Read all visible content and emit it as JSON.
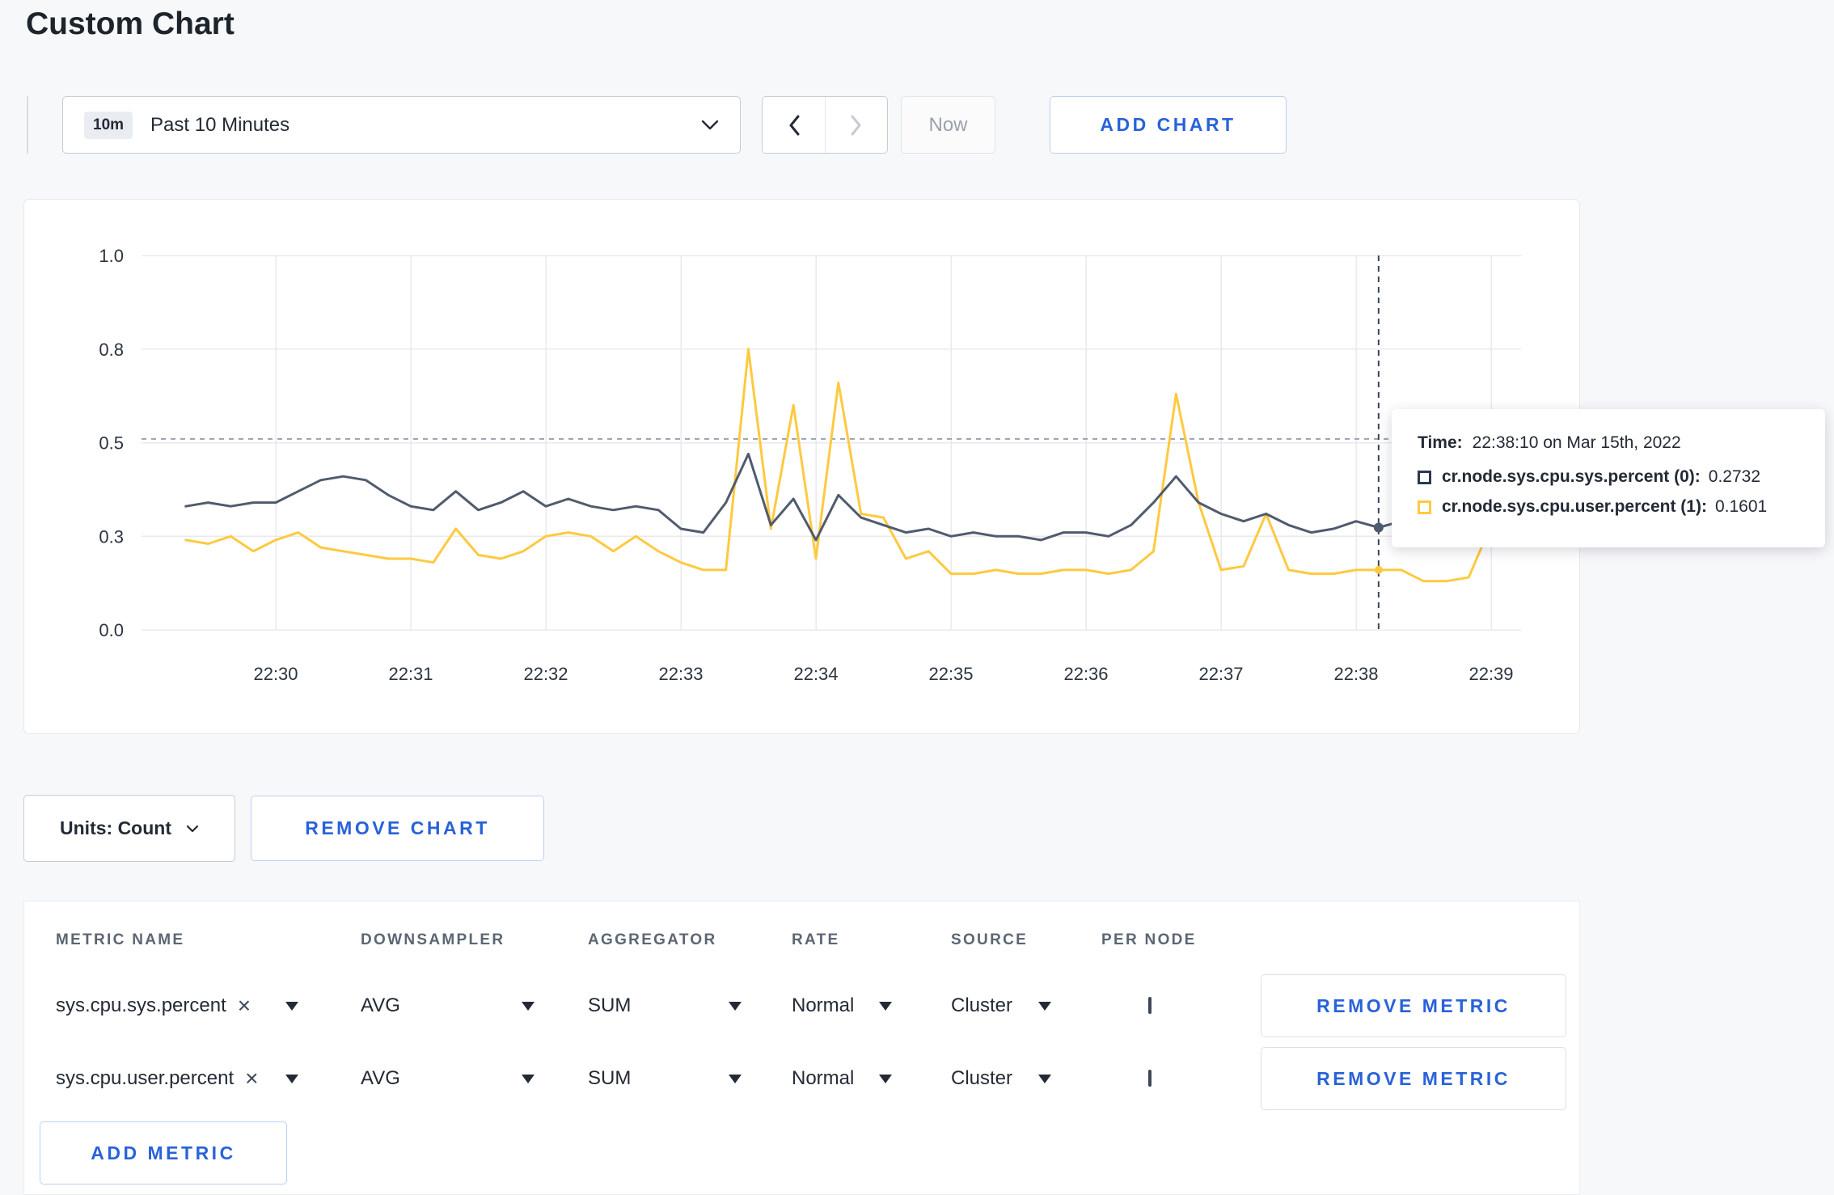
{
  "page": {
    "title": "Custom Chart"
  },
  "toolbar": {
    "time_range_badge": "10m",
    "time_range_label": "Past 10 Minutes",
    "prev_icon": "chevron-left-icon",
    "next_icon": "chevron-right-icon",
    "now_label": "Now",
    "add_chart_label": "ADD CHART"
  },
  "tooltip": {
    "time_label": "Time:",
    "time_value": "22:38:10 on Mar 15th, 2022",
    "rows": [
      {
        "name": "cr.node.sys.cpu.sys.percent (0):",
        "value": "0.2732",
        "color": "#2c3850"
      },
      {
        "name": "cr.node.sys.cpu.user.percent (1):",
        "value": "0.1601",
        "color": "#ffc940"
      }
    ]
  },
  "chart_controls": {
    "units_label": "Units: Count",
    "remove_chart_label": "REMOVE CHART",
    "add_metric_label": "ADD METRIC"
  },
  "table": {
    "headers": [
      "METRIC NAME",
      "DOWNSAMPLER",
      "AGGREGATOR",
      "RATE",
      "SOURCE",
      "PER NODE"
    ],
    "remove_metric_label": "REMOVE METRIC",
    "rows": [
      {
        "metric": "sys.cpu.sys.percent",
        "clear": "×",
        "downsampler": "AVG",
        "aggregator": "SUM",
        "rate": "Normal",
        "source": "Cluster",
        "per_node_checked": false
      },
      {
        "metric": "sys.cpu.user.percent",
        "clear": "×",
        "downsampler": "AVG",
        "aggregator": "SUM",
        "rate": "Normal",
        "source": "Cluster",
        "per_node_checked": false
      }
    ]
  },
  "chart_data": {
    "type": "line",
    "title": "",
    "xlabel": "",
    "ylabel": "",
    "x_axis": {
      "ticks": [
        "22:30",
        "22:31",
        "22:32",
        "22:33",
        "22:34",
        "22:35",
        "22:36",
        "22:37",
        "22:38",
        "22:39"
      ]
    },
    "y_axis": {
      "range": [
        0,
        1
      ],
      "ticks": [
        {
          "label": "1.0",
          "value": 1.0
        },
        {
          "label": "0.8",
          "value": 0.75
        },
        {
          "label": "0.5",
          "value": 0.5
        },
        {
          "label": "0.3",
          "value": 0.25
        },
        {
          "label": "0.0",
          "value": 0.0
        }
      ]
    },
    "grid": true,
    "legend_position": "tooltip",
    "x_start_time": "22:29:20",
    "x_step_seconds": 10,
    "x_start_offset_minutes": -0.6667,
    "x_step_minutes": 0.16667,
    "series": [
      {
        "name": "cr.node.sys.cpu.sys.percent",
        "color": "#515b6e",
        "values": [
          0.33,
          0.34,
          0.33,
          0.34,
          0.34,
          0.37,
          0.4,
          0.41,
          0.4,
          0.36,
          0.33,
          0.32,
          0.37,
          0.32,
          0.34,
          0.37,
          0.33,
          0.35,
          0.33,
          0.32,
          0.33,
          0.32,
          0.27,
          0.26,
          0.34,
          0.47,
          0.28,
          0.35,
          0.24,
          0.36,
          0.3,
          0.28,
          0.26,
          0.27,
          0.25,
          0.26,
          0.25,
          0.25,
          0.24,
          0.26,
          0.26,
          0.25,
          0.28,
          0.34,
          0.41,
          0.34,
          0.31,
          0.29,
          0.31,
          0.28,
          0.26,
          0.27,
          0.29,
          0.2732,
          0.29,
          0.28,
          0.28,
          0.29,
          0.28,
          0.28
        ]
      },
      {
        "name": "cr.node.sys.cpu.user.percent",
        "color": "#ffc940",
        "values": [
          0.24,
          0.23,
          0.25,
          0.21,
          0.24,
          0.26,
          0.22,
          0.21,
          0.2,
          0.19,
          0.19,
          0.18,
          0.27,
          0.2,
          0.19,
          0.21,
          0.25,
          0.26,
          0.25,
          0.21,
          0.25,
          0.21,
          0.18,
          0.16,
          0.16,
          0.75,
          0.27,
          0.6,
          0.19,
          0.66,
          0.31,
          0.3,
          0.19,
          0.21,
          0.15,
          0.15,
          0.16,
          0.15,
          0.15,
          0.16,
          0.16,
          0.15,
          0.16,
          0.21,
          0.63,
          0.34,
          0.16,
          0.17,
          0.31,
          0.16,
          0.15,
          0.15,
          0.16,
          0.1601,
          0.16,
          0.13,
          0.13,
          0.14,
          0.28,
          0.24
        ]
      }
    ],
    "crosshair": {
      "time": "22:38:10",
      "x_offset_minutes": 8.1667,
      "hline_value": 0.51,
      "values": [
        0.2732,
        0.1601
      ]
    }
  }
}
